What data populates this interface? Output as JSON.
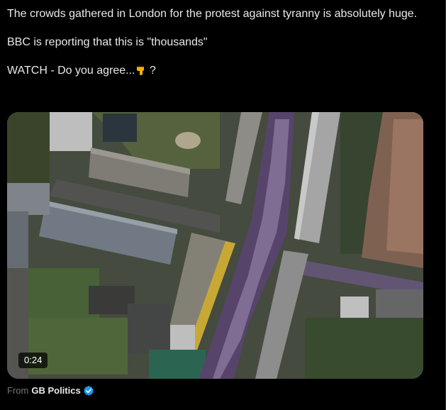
{
  "tweet": {
    "line1": "The crowds gathered in London for the protest against tyranny is absolutely huge.",
    "line2": "BBC is reporting that this is \"thousands\"",
    "line3_prefix": "WATCH - Do you agree...",
    "line3_suffix": " ?",
    "emoji_icon": "pointing-down-hand-icon"
  },
  "video": {
    "duration": "0:24"
  },
  "source": {
    "prefix": "From",
    "account": "GB Politics",
    "verified_icon": "verified-badge-icon",
    "verified_color": "#1d9bf0"
  },
  "colors": {
    "background": "#000000",
    "text": "#e7e9ea",
    "muted": "#71767b"
  }
}
